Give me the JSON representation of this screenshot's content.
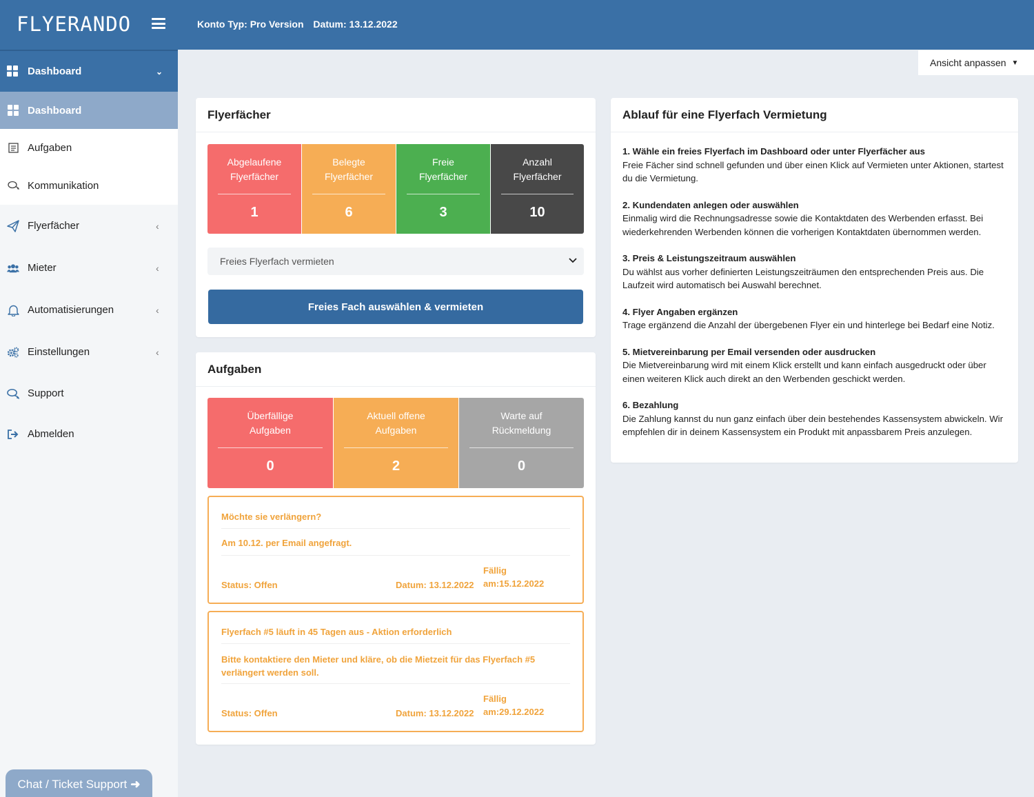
{
  "app": {
    "logo": "FLYERANDO"
  },
  "topbar": {
    "konto": "Konto Typ: Pro Version",
    "datum": "Datum: 13.12.2022"
  },
  "sidebar": {
    "head": "Dashboard",
    "sub": [
      "Dashboard",
      "Aufgaben",
      "Kommunikation"
    ],
    "main": [
      {
        "label": "Flyerfächer",
        "arrow": true
      },
      {
        "label": "Mieter",
        "arrow": true
      },
      {
        "label": "Automatisierungen",
        "arrow": true
      },
      {
        "label": "Einstellungen",
        "arrow": true
      },
      {
        "label": "Support",
        "arrow": false
      },
      {
        "label": "Abmelden",
        "arrow": false
      }
    ],
    "chat": "Chat / Ticket Support"
  },
  "ansicht": "Ansicht anpassen",
  "flyerfaecher": {
    "title": "Flyerfächer",
    "stats": [
      {
        "l1": "Abgelaufene",
        "l2": "Flyerfächer",
        "value": "1",
        "color": "#f56c6c"
      },
      {
        "l1": "Belegte",
        "l2": "Flyerfächer",
        "value": "6",
        "color": "#f6ad55"
      },
      {
        "l1": "Freie",
        "l2": "Flyerfächer",
        "value": "3",
        "color": "#4caf50"
      },
      {
        "l1": "Anzahl",
        "l2": "Flyerfächer",
        "value": "10",
        "color": "#484848"
      }
    ],
    "select_value": "Freies Flyerfach vermieten",
    "button": "Freies Fach auswählen & vermieten"
  },
  "aufgaben": {
    "title": "Aufgaben",
    "stats": [
      {
        "l1": "Überfällige",
        "l2": "Aufgaben",
        "value": "0",
        "color": "#f56c6c"
      },
      {
        "l1": "Aktuell offene",
        "l2": "Aufgaben",
        "value": "2",
        "color": "#f6ad55"
      },
      {
        "l1": "Warte auf",
        "l2": "Rückmeldung",
        "value": "0",
        "color": "#a6a6a6"
      }
    ],
    "tasks": [
      {
        "title": "Möchte sie verlängern?",
        "text": "Am 10.12. per Email angefragt.",
        "status": "Status: Offen",
        "datum": "Datum: 13.12.2022",
        "faellig1": "Fällig",
        "faellig2": "am:15.12.2022"
      },
      {
        "title": "Flyerfach #5 läuft in 45 Tagen aus - Aktion erforderlich",
        "text": "Bitte kontaktiere den Mieter und kläre, ob die Mietzeit für das Flyerfach #5 verlängert werden soll.",
        "status": "Status: Offen",
        "datum": "Datum: 13.12.2022",
        "faellig1": "Fällig",
        "faellig2": "am:29.12.2022"
      }
    ]
  },
  "ablauf": {
    "title": "Ablauf für eine Flyerfach Vermietung",
    "steps": [
      {
        "head": "1. Wähle ein freies Flyerfach im Dashboard oder unter Flyerfächer aus",
        "body": "Freie Fächer sind schnell gefunden und über einen Klick auf Vermieten unter Aktionen, startest du die Vermietung."
      },
      {
        "head": "2. Kundendaten anlegen oder auswählen",
        "body": "Einmalig wird die Rechnungsadresse sowie die Kontaktdaten des Werbenden erfasst. Bei wiederkehrenden Werbenden können die vorherigen Kontaktdaten übernommen werden."
      },
      {
        "head": "3. Preis & Leistungszeitraum auswählen",
        "body": "Du wählst aus vorher definierten Leistungszeiträumen den entsprechenden Preis aus. Die Laufzeit wird automatisch bei Auswahl berechnet."
      },
      {
        "head": "4. Flyer Angaben ergänzen",
        "body": "Trage ergänzend die Anzahl der übergebenen Flyer ein und hinterlege bei Bedarf eine Notiz."
      },
      {
        "head": "5. Mietvereinbarung per Email versenden oder ausdrucken",
        "body": "Die Mietvereinbarung wird mit einem Klick erstellt und kann einfach ausgedruckt oder über einen weiteren Klick auch direkt an den Werbenden geschickt werden."
      },
      {
        "head": "6. Bezahlung",
        "body": "Die Zahlung kannst du nun ganz einfach über dein bestehendes Kassensystem abwickeln. Wir empfehlen dir in deinem Kassensystem ein Produkt mit anpassbarem Preis anzulegen."
      }
    ]
  }
}
